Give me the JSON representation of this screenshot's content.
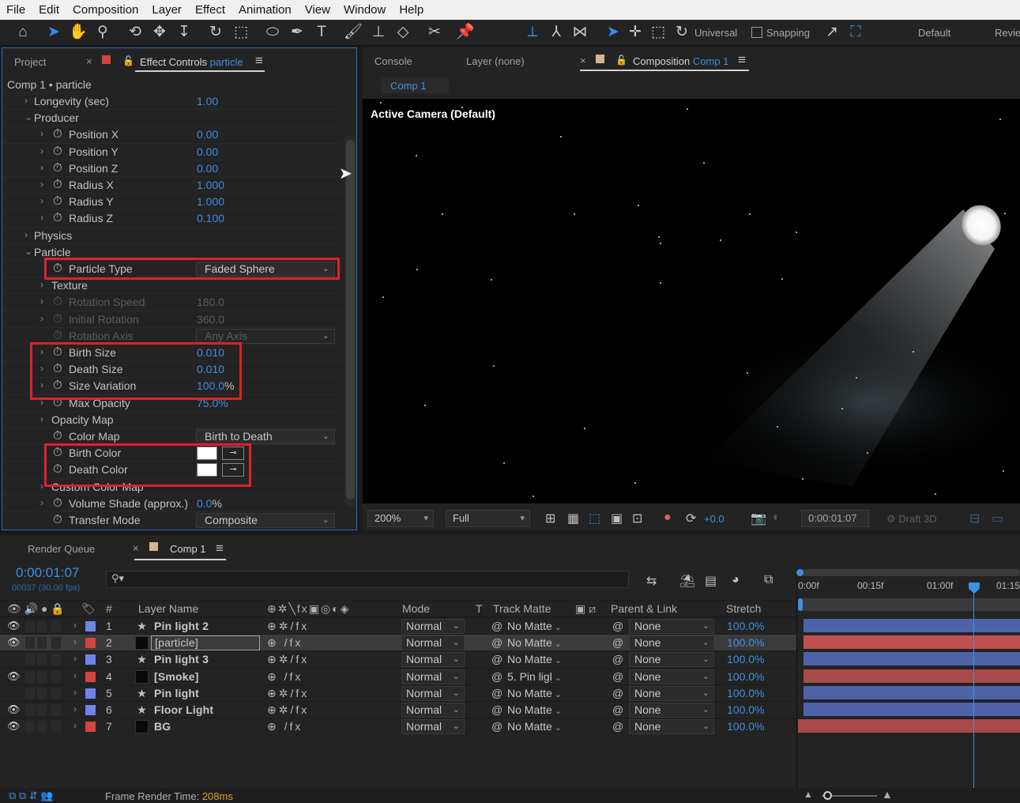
{
  "menu": [
    "File",
    "Edit",
    "Composition",
    "Layer",
    "Effect",
    "Animation",
    "View",
    "Window",
    "Help"
  ],
  "toolbar": {
    "universal_label": "Universal",
    "snapping_label": "Snapping",
    "workspace": "Default",
    "workspace2": "Revie"
  },
  "effect_controls": {
    "tab_project": "Project",
    "tab_prefix": "Effect Controls",
    "tab_layer": "particle",
    "breadcrumb": "Comp 1 • particle",
    "props": [
      {
        "label": "Longevity (sec)",
        "value": "1.00"
      },
      {
        "label": "Producer",
        "value": ""
      },
      {
        "label": "Position X",
        "value": "0.00"
      },
      {
        "label": "Position Y",
        "value": "0.00"
      },
      {
        "label": "Position Z",
        "value": "0.00"
      },
      {
        "label": "Radius X",
        "value": "1.000"
      },
      {
        "label": "Radius Y",
        "value": "1.000"
      },
      {
        "label": "Radius Z",
        "value": "0.100"
      },
      {
        "label": "Physics",
        "value": ""
      },
      {
        "label": "Particle",
        "value": ""
      },
      {
        "label": "Particle Type",
        "value": "Faded Sphere"
      },
      {
        "label": "Texture",
        "value": ""
      },
      {
        "label": "Rotation Speed",
        "value": "180.0"
      },
      {
        "label": "Initial Rotation",
        "value": "360.0"
      },
      {
        "label": "Rotation Axis",
        "value": "Any Axis"
      },
      {
        "label": "Birth Size",
        "value": "0.010"
      },
      {
        "label": "Death Size",
        "value": "0.010"
      },
      {
        "label": "Size Variation",
        "value": "100.0",
        "unit": "%"
      },
      {
        "label": "Max Opacity",
        "value": "75.0%"
      },
      {
        "label": "Opacity Map",
        "value": ""
      },
      {
        "label": "Color Map",
        "value": "Birth to Death"
      },
      {
        "label": "Birth Color",
        "value": ""
      },
      {
        "label": "Death Color",
        "value": ""
      },
      {
        "label": "Custom Color Map",
        "value": ""
      },
      {
        "label": "Volume Shade (approx.)",
        "value": "0.0",
        "unit": "%"
      },
      {
        "label": "Transfer Mode",
        "value": "Composite"
      }
    ]
  },
  "composition": {
    "tab_console": "Console",
    "tab_layer": "Layer (none)",
    "tab_prefix": "Composition",
    "tab_comp": "Comp 1",
    "subtab": "Comp 1",
    "camera_label": "Active Camera (Default)",
    "zoom": "200%",
    "resolution": "Full",
    "exposure": "+0.0",
    "timecode": "0:00:01:07",
    "renderer": "Draft 3D"
  },
  "timeline": {
    "tab_render": "Render Queue",
    "tab_comp": "Comp 1",
    "timecode": "0:00:01:07",
    "frame_info": "00037 (30.00 fps)",
    "headers": {
      "layer_name": "Layer Name",
      "mode": "Mode",
      "t": "T",
      "track_matte": "Track Matte",
      "parent": "Parent & Link",
      "stretch": "Stretch",
      "num": "#"
    },
    "ruler": [
      "0:00f",
      "00:15f",
      "01:00f",
      "01:15"
    ],
    "layers": [
      {
        "num": "1",
        "name": "Pin light 2",
        "mode": "Normal",
        "matte": "No Matte",
        "parent": "None",
        "stretch": "100.0%",
        "color": "#6d86e6",
        "kind": "light",
        "eye": true
      },
      {
        "num": "2",
        "name": "[particle]",
        "mode": "Normal",
        "matte": "No Matte",
        "parent": "None",
        "stretch": "100.0%",
        "color": "#d2453e",
        "kind": "solid",
        "eye": true
      },
      {
        "num": "3",
        "name": "Pin light 3",
        "mode": "Normal",
        "matte": "No Matte",
        "parent": "None",
        "stretch": "100.0%",
        "color": "#6d86e6",
        "kind": "light",
        "eye": false
      },
      {
        "num": "4",
        "name": "[Smoke]",
        "mode": "Normal",
        "matte": "5. Pin ligl",
        "parent": "None",
        "stretch": "100.0%",
        "color": "#d2453e",
        "kind": "solid",
        "eye": true
      },
      {
        "num": "5",
        "name": "Pin light",
        "mode": "Normal",
        "matte": "No Matte",
        "parent": "None",
        "stretch": "100.0%",
        "color": "#6d86e6",
        "kind": "light",
        "eye": false
      },
      {
        "num": "6",
        "name": "Floor Light",
        "mode": "Normal",
        "matte": "No Matte",
        "parent": "None",
        "stretch": "100.0%",
        "color": "#6d86e6",
        "kind": "light",
        "eye": true
      },
      {
        "num": "7",
        "name": "BG",
        "mode": "Normal",
        "matte": "No Matte",
        "parent": "None",
        "stretch": "100.0%",
        "color": "#d2453e",
        "kind": "solid",
        "eye": true
      }
    ]
  },
  "status": {
    "label": "Frame Render Time:",
    "value": "208ms"
  },
  "colors": {
    "accent": "#3d8fe0",
    "highlight_box": "#e0202a",
    "light_bar": "#4e63a7",
    "solid_bar": "#a94a4a"
  }
}
